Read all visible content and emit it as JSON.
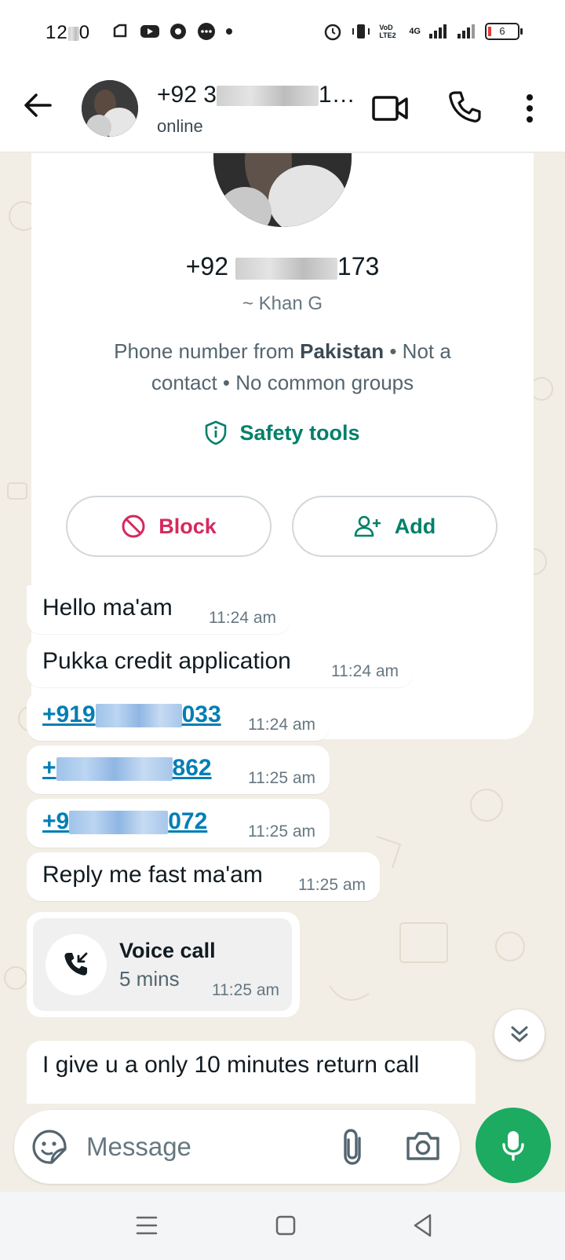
{
  "status_bar": {
    "time": "12",
    "time_suffix": "0",
    "battery": "6",
    "network": "4G",
    "volte": "VoD LTE2"
  },
  "header": {
    "title_prefix": "+92 3",
    "title_suffix": "1…",
    "subtitle": "online"
  },
  "info_card": {
    "phone_prefix": "+92 ",
    "phone_suffix": "173",
    "display_name": "~ Khan G",
    "desc_part1": "Phone number from ",
    "desc_country": "Pakistan",
    "desc_part2": " • Not a contact • No common groups",
    "safety_label": "Safety tools",
    "block_label": "Block",
    "add_label": "Add"
  },
  "messages": [
    {
      "text": "Hello ma'am",
      "time": "11:24 am"
    },
    {
      "text": "Pukka credit application",
      "time": "11:24 am"
    },
    {
      "link_prefix": "+919",
      "link_suffix": "033",
      "time": "11:24 am"
    },
    {
      "link_prefix": "+",
      "link_suffix": "862",
      "time": "11:25 am"
    },
    {
      "link_prefix": "+9",
      "link_suffix": "072",
      "time": "11:25 am"
    },
    {
      "text": "Reply me fast ma'am",
      "time": "11:25 am"
    }
  ],
  "voice_call": {
    "title": "Voice call",
    "duration": "5 mins",
    "time": "11:25 am"
  },
  "last_message": {
    "text": "I give u a only 10 minutes return call"
  },
  "composer": {
    "placeholder": "Message"
  },
  "colors": {
    "accent_green": "#008069",
    "send_green": "#1daa61",
    "block_red": "#d42a5e",
    "link_blue": "#027eb5"
  }
}
